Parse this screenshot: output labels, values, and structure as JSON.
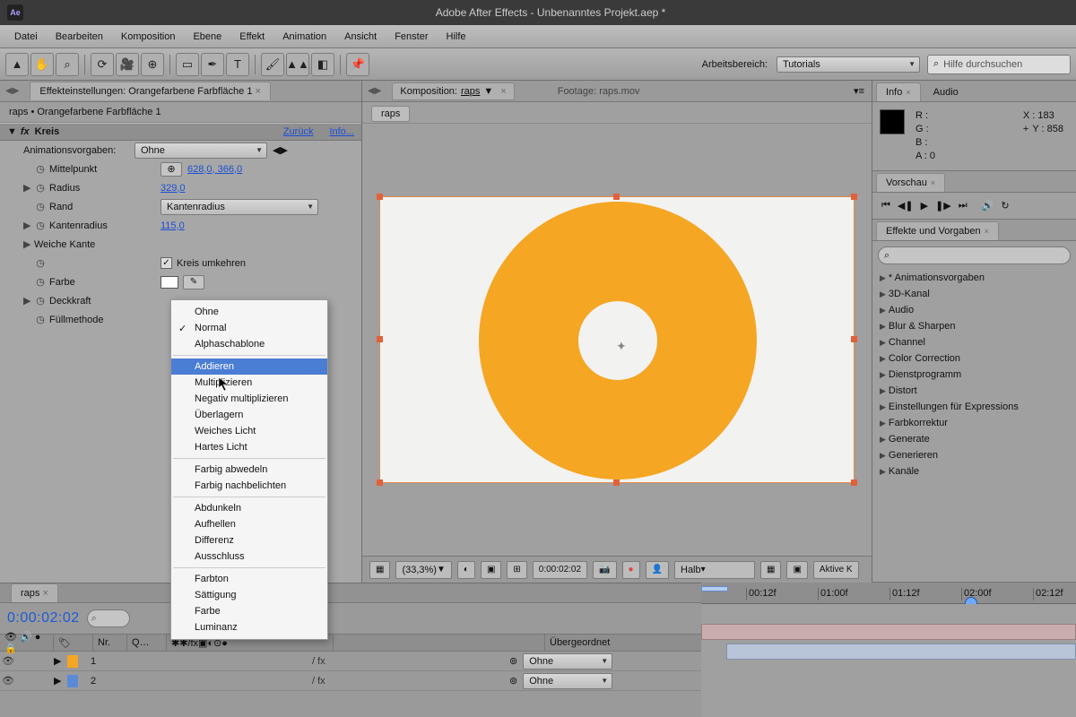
{
  "titlebar": {
    "logo": "Ae",
    "title": "Adobe After Effects - Unbenanntes Projekt.aep *"
  },
  "menu": [
    "Datei",
    "Bearbeiten",
    "Komposition",
    "Ebene",
    "Effekt",
    "Animation",
    "Ansicht",
    "Fenster",
    "Hilfe"
  ],
  "workspace": {
    "label": "Arbeitsbereich:",
    "value": "Tutorials",
    "search_placeholder": "Hilfe durchsuchen"
  },
  "effect_panel": {
    "tab": "Effekteinstellungen: Orangefarbene Farbfläche 1",
    "breadcrumb": "raps • Orangefarbene Farbfläche 1",
    "effect_name": "Kreis",
    "back": "Zurück",
    "info": "Info...",
    "preset_label": "Animationsvorgaben:",
    "preset_value": "Ohne",
    "rows": {
      "mittelpunkt": {
        "label": "Mittelpunkt",
        "value": "628,0, 366,0"
      },
      "radius": {
        "label": "Radius",
        "value": "329,0"
      },
      "rand": {
        "label": "Rand",
        "value": "Kantenradius"
      },
      "kantenradius": {
        "label": "Kantenradius",
        "value": "115,0"
      },
      "weiche": {
        "label": "Weiche Kante"
      },
      "invert": {
        "label": "Kreis umkehren"
      },
      "farbe": {
        "label": "Farbe"
      },
      "deckkraft": {
        "label": "Deckkraft"
      },
      "fuell": {
        "label": "Füllmethode"
      }
    }
  },
  "context_menu": {
    "groups": [
      [
        "Ohne",
        "Normal",
        "Alphaschablone"
      ],
      [
        "Addieren",
        "Multiplizieren",
        "Negativ multiplizieren",
        "Überlagern",
        "Weiches Licht",
        "Hartes Licht"
      ],
      [
        "Farbig abwedeln",
        "Farbig nachbelichten"
      ],
      [
        "Abdunkeln",
        "Aufhellen",
        "Differenz",
        "Ausschluss"
      ],
      [
        "Farbton",
        "Sättigung",
        "Farbe",
        "Luminanz"
      ]
    ],
    "checked": "Normal",
    "selected": "Addieren"
  },
  "comp": {
    "tab_label": "Komposition:",
    "tab_value": "raps",
    "footage": "Footage: raps.mov",
    "mini_tab": "raps"
  },
  "viewer_footer": {
    "zoom": "(33,3%)",
    "time": "0:00:02:02",
    "res": "Halb",
    "view": "Aktive K"
  },
  "info": {
    "tab1": "Info",
    "tab2": "Audio",
    "r": "R :",
    "g": "G :",
    "b": "B :",
    "a": "A :   0",
    "x": "X : 183",
    "y": "Y : 858"
  },
  "preview": {
    "tab": "Vorschau"
  },
  "effects_presets": {
    "tab": "Effekte und Vorgaben",
    "search_icon": "⌕",
    "cats": [
      "* Animationsvorgaben",
      "3D-Kanal",
      "Audio",
      "Blur & Sharpen",
      "Channel",
      "Color Correction",
      "Dienstprogramm",
      "Distort",
      "Einstellungen für Expressions",
      "Farbkorrektur",
      "Generate",
      "Generieren",
      "Kanäle"
    ]
  },
  "timeline": {
    "tab": "raps",
    "timecode": "0:00:02:02",
    "col_nr": "Nr.",
    "col_q": "Q…",
    "col_parent": "Übergeordnet",
    "parent_value": "Ohne",
    "marks": [
      "00:12f",
      "01:00f",
      "01:12f",
      "02:00f",
      "02:12f"
    ],
    "layers": [
      {
        "num": "1",
        "color": "#f5a623"
      },
      {
        "num": "2",
        "color": "#5a8ad6"
      }
    ]
  }
}
